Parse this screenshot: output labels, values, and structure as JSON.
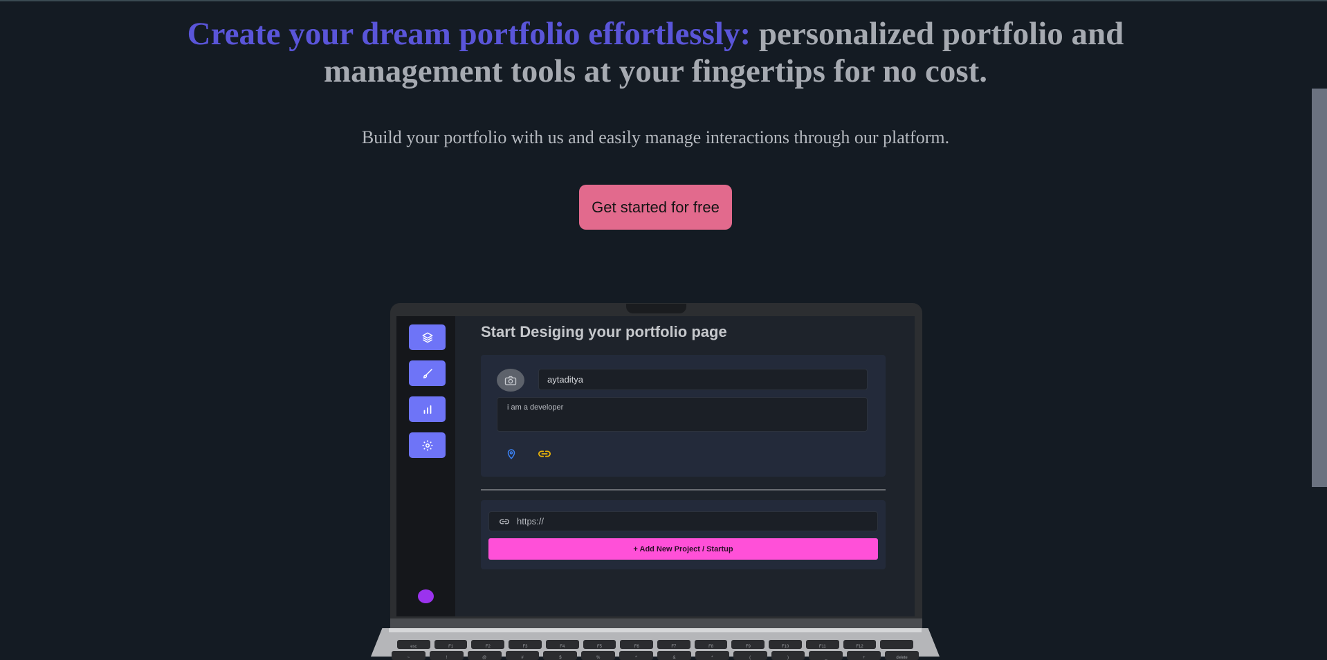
{
  "hero": {
    "title_accent": "Create your dream portfolio effortlessly:",
    "title_rest": "personalized portfolio and management tools at your fingertips for no cost.",
    "subtitle": "Build your portfolio with us and easily manage interactions through our platform.",
    "cta_label": "Get started for free"
  },
  "colors": {
    "background": "#141b23",
    "accent_title": "#5a55d9",
    "cta": "#e26a8d",
    "sidebar_button": "#6e74f7",
    "add_button": "#ff50d8",
    "avatar": "#9b33ee"
  },
  "mockup": {
    "heading": "Start Desiging your portfolio page",
    "sidebar_icons": [
      "layers-icon",
      "brush-icon",
      "bar-chart-icon",
      "settings-icon"
    ],
    "name_value": "aytaditya",
    "bio_value": "i am a developer",
    "url_placeholder": "https://",
    "add_button_label": "+ Add New Project / Startup",
    "keys_row1": [
      "esc",
      "F1",
      "F2",
      "F3",
      "F4",
      "F5",
      "F6",
      "F7",
      "F8",
      "F9",
      "F10",
      "F11",
      "F12",
      ""
    ],
    "keys_row2": [
      "~",
      "!",
      "@",
      "#",
      "$",
      "%",
      "^",
      "&",
      "*",
      "(",
      ")",
      "_",
      "+",
      "delete"
    ]
  }
}
